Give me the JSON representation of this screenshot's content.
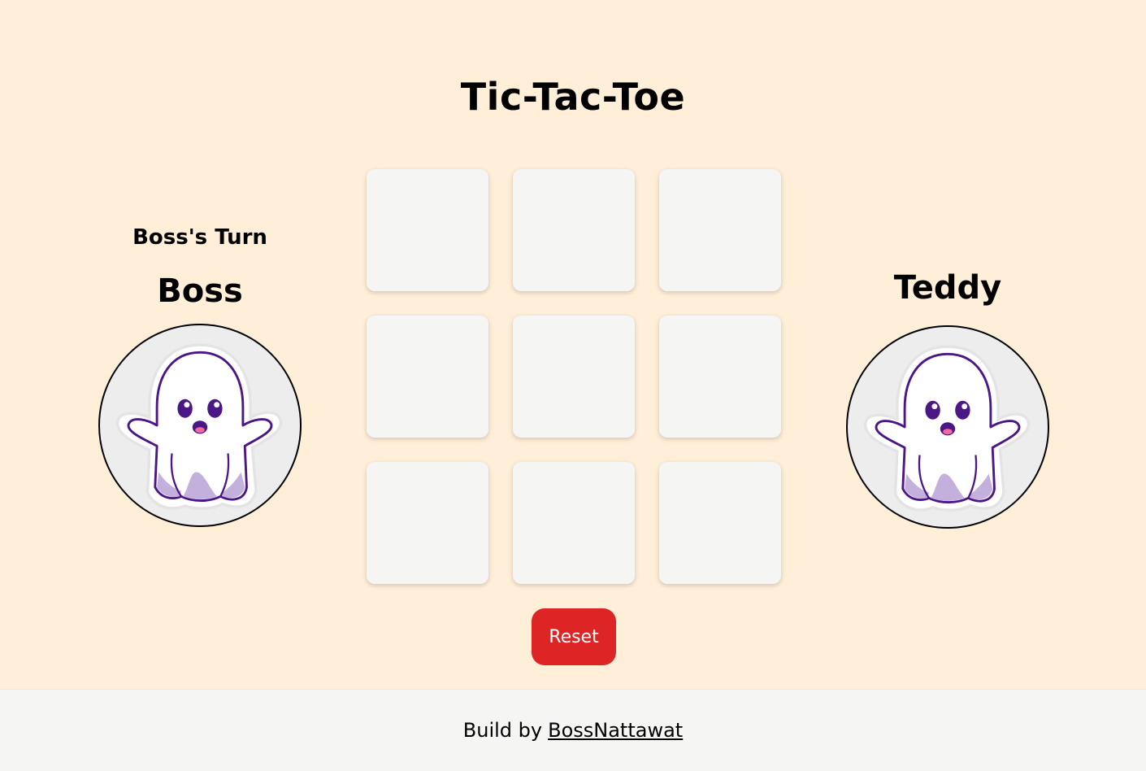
{
  "title": "Tic-Tac-Toe",
  "status": {
    "turn_text": "Boss's Turn"
  },
  "players": {
    "left": {
      "name": "Boss",
      "avatar": "ghost-icon"
    },
    "right": {
      "name": "Teddy",
      "avatar": "ghost-icon"
    }
  },
  "board": {
    "cells": [
      "",
      "",
      "",
      "",
      "",
      "",
      "",
      "",
      ""
    ]
  },
  "reset_label": "Reset",
  "footer": {
    "prefix": "Build by",
    "author_link": "BossNattawat"
  },
  "colors": {
    "background": "#FFEED8",
    "cell": "#F5F5F4",
    "reset": "#DD2525",
    "footer": "#F5F5F4",
    "ghost_outline": "#4B1685",
    "ghost_shadow": "#C4B0DC"
  }
}
